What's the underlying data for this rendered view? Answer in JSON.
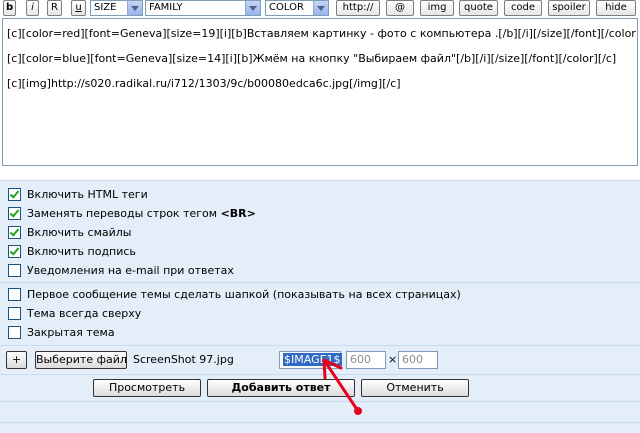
{
  "toolbar": {
    "bold": "b",
    "italic": "i",
    "r": "R",
    "underline": "u",
    "size_select": "SIZE",
    "family_select": "FAMILY",
    "color_select": "COLOR",
    "http": "http://",
    "at": "@",
    "img": "img",
    "quote": "quote",
    "code": "code",
    "spoiler": "spoiler",
    "hide": "hide"
  },
  "editor": {
    "lines": [
      "[c][color=red][font=Geneva][size=19][i][b]Вставляем картинку - фото с компьютера .[/b][/i][/size][/font][/color][/c]",
      "[c][color=blue][font=Geneva][size=14][i][b]Жмём на кнопку \"Выбираем файл\"[/b][/i][/size][/font][/color][/c]",
      "[c][img]http://s020.radikal.ru/i712/1303/9c/b00080edca6c.jpg[/img][/c]"
    ]
  },
  "options": [
    {
      "label": "Включить HTML теги",
      "checked": true
    },
    {
      "label_prefix": "Заменять переводы строк тегом ",
      "label_bold": "<BR>",
      "checked": true
    },
    {
      "label": "Включить смайлы",
      "checked": true
    },
    {
      "label": "Включить подпись",
      "checked": true
    },
    {
      "label": "Уведомления на e-mail при ответах",
      "checked": false
    }
  ],
  "topic_options": [
    {
      "label": "Первое сообщение темы сделать шапкой (показывать на всех страницах)",
      "checked": false
    },
    {
      "label": "Тема всегда сверху",
      "checked": false
    },
    {
      "label": "Закрытая тема",
      "checked": false
    }
  ],
  "upload": {
    "add_label": "+",
    "choose_file_label": "Выберите файл",
    "file_name": "ScreenShot 97.jpg",
    "image_tag": "$IMAGE1$",
    "width_value": "600",
    "times": "×",
    "height_value": "600"
  },
  "actions": {
    "preview": "Просмотреть",
    "submit": "Добавить ответ",
    "cancel": "Отменить"
  },
  "annotation": {
    "arrow_color": "#e8001c",
    "arrow_icon": "red-arrow-icon"
  }
}
